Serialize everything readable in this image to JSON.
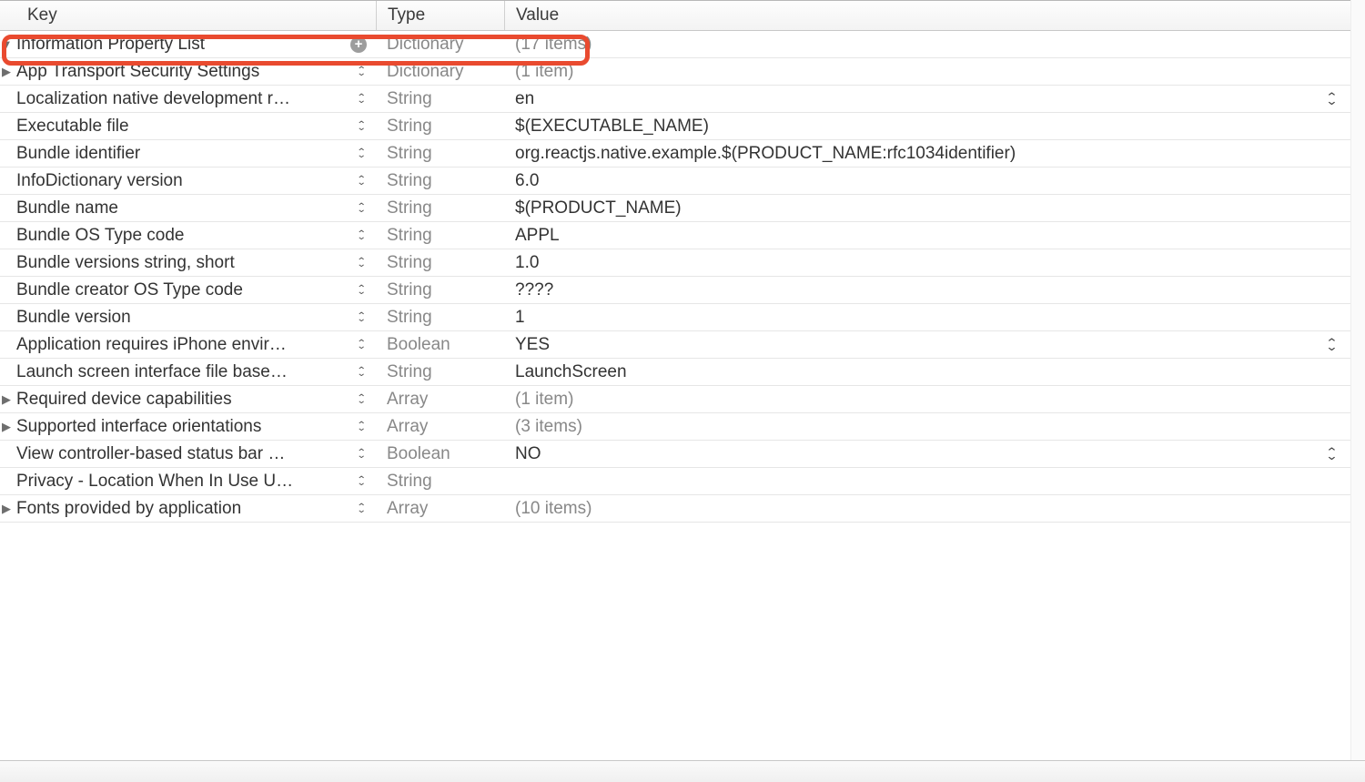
{
  "columns": {
    "key": "Key",
    "type": "Type",
    "value": "Value"
  },
  "root": {
    "key": "Information Property List",
    "type": "Dictionary",
    "value": "(17 items)"
  },
  "rows": [
    {
      "key": "App Transport Security Settings",
      "type": "Dictionary",
      "value": "(1 item)",
      "disclosure": "right",
      "valDim": true
    },
    {
      "key": "Localization native development re…",
      "type": "String",
      "value": "en",
      "disclosure": "none",
      "bigStepper": true
    },
    {
      "key": "Executable file",
      "type": "String",
      "value": "$(EXECUTABLE_NAME)",
      "disclosure": "none"
    },
    {
      "key": "Bundle identifier",
      "type": "String",
      "value": "org.reactjs.native.example.$(PRODUCT_NAME:rfc1034identifier)",
      "disclosure": "none"
    },
    {
      "key": "InfoDictionary version",
      "type": "String",
      "value": "6.0",
      "disclosure": "none"
    },
    {
      "key": "Bundle name",
      "type": "String",
      "value": "$(PRODUCT_NAME)",
      "disclosure": "none"
    },
    {
      "key": "Bundle OS Type code",
      "type": "String",
      "value": "APPL",
      "disclosure": "none"
    },
    {
      "key": "Bundle versions string, short",
      "type": "String",
      "value": "1.0",
      "disclosure": "none"
    },
    {
      "key": "Bundle creator OS Type code",
      "type": "String",
      "value": "????",
      "disclosure": "none"
    },
    {
      "key": "Bundle version",
      "type": "String",
      "value": "1",
      "disclosure": "none"
    },
    {
      "key": "Application requires iPhone enviro…",
      "type": "Boolean",
      "value": "YES",
      "disclosure": "none",
      "bigStepper": true
    },
    {
      "key": "Launch screen interface file base…",
      "type": "String",
      "value": "LaunchScreen",
      "disclosure": "none"
    },
    {
      "key": "Required device capabilities",
      "type": "Array",
      "value": "(1 item)",
      "disclosure": "right",
      "valDim": true
    },
    {
      "key": "Supported interface orientations",
      "type": "Array",
      "value": "(3 items)",
      "disclosure": "right",
      "valDim": true
    },
    {
      "key": "View controller-based status bar a…",
      "type": "Boolean",
      "value": "NO",
      "disclosure": "none",
      "bigStepper": true
    },
    {
      "key": "Privacy - Location When In Use Us…",
      "type": "String",
      "value": "",
      "disclosure": "none"
    },
    {
      "key": "Fonts provided by application",
      "type": "Array",
      "value": "(10 items)",
      "disclosure": "right",
      "valDim": true
    }
  ]
}
